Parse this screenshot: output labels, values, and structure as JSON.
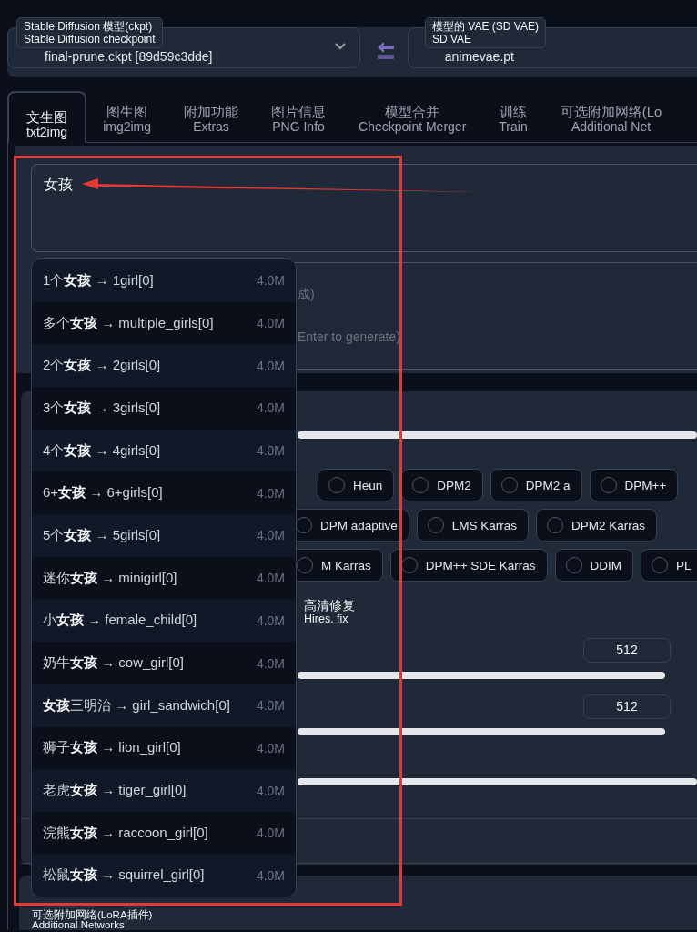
{
  "top_bar": {
    "checkpoint": {
      "label": "Stable Diffusion 模型(ckpt)",
      "sublabel": "Stable Diffusion checkpoint",
      "value": "final-prune.ckpt [89d59c3dde]"
    },
    "vae": {
      "label": "模型的 VAE (SD VAE)",
      "sublabel": "SD VAE",
      "value": "animevae.pt"
    }
  },
  "tabs": [
    {
      "label": "文生图",
      "sublabel": "txt2img",
      "selected": true
    },
    {
      "label": "图生图",
      "sublabel": "img2img",
      "selected": false
    },
    {
      "label": "附加功能",
      "sublabel": "Extras",
      "selected": false
    },
    {
      "label": "图片信息",
      "sublabel": "PNG Info",
      "selected": false
    },
    {
      "label": "模型合并",
      "sublabel": "Checkpoint Merger",
      "selected": false
    },
    {
      "label": "训练",
      "sublabel": "Train",
      "selected": false
    },
    {
      "label": "可选附加网络(Lo",
      "sublabel": "Additional Net",
      "selected": false
    }
  ],
  "prompt": {
    "value": "女孩"
  },
  "negative_prompt": {
    "placeholder": [
      "成)",
      "Enter to generate)"
    ]
  },
  "sampler_rows": [
    [
      {
        "label": "Heun",
        "selected": false
      },
      {
        "label": "DPM2",
        "selected": false
      },
      {
        "label": "DPM2 a",
        "selected": false
      },
      {
        "label": "DPM++",
        "selected": false
      }
    ],
    [
      {
        "label": "DPM adaptive",
        "selected": false
      },
      {
        "label": "LMS Karras",
        "selected": false
      },
      {
        "label": "DPM2 Karras",
        "selected": false
      }
    ],
    [
      {
        "label": "M Karras",
        "selected": false
      },
      {
        "label": "DPM++ SDE Karras",
        "selected": false
      },
      {
        "label": "DDIM",
        "selected": false
      },
      {
        "label": "PL",
        "selected": false
      }
    ]
  ],
  "hires_fix": {
    "label": "高清修复",
    "sublabel": "Hires. fix"
  },
  "width": {
    "value": "512"
  },
  "height": {
    "value": "512"
  },
  "additional_networks": {
    "label": "可选附加网络(LoRA插件)",
    "sublabel": "Additional Networks"
  },
  "autocomplete": [
    {
      "text": "1个**女孩** → 1girl[0]",
      "count": "4.0M"
    },
    {
      "text": "多个**女孩** → multiple_girls[0]",
      "count": "4.0M"
    },
    {
      "text": "2个**女孩** → 2girls[0]",
      "count": "4.0M"
    },
    {
      "text": "3个**女孩** → 3girls[0]",
      "count": "4.0M"
    },
    {
      "text": "4个**女孩** → 4girls[0]",
      "count": "4.0M"
    },
    {
      "text": "6+**女孩** → 6+girls[0]",
      "count": "4.0M"
    },
    {
      "text": "5个**女孩** → 5girls[0]",
      "count": "4.0M"
    },
    {
      "text": "迷你**女孩** → minigirl[0]",
      "count": "4.0M"
    },
    {
      "text": "小**女孩** → female_child[0]",
      "count": "4.0M"
    },
    {
      "text": "奶牛**女孩** → cow_girl[0]",
      "count": "4.0M"
    },
    {
      "text": "**女孩**三明治 → girl_sandwich[0]",
      "count": "4.0M"
    },
    {
      "text": "狮子**女孩** → lion_girl[0]",
      "count": "4.0M"
    },
    {
      "text": "老虎**女孩** → tiger_girl[0]",
      "count": "4.0M"
    },
    {
      "text": "浣熊**女孩** → raccoon_girl[0]",
      "count": "4.0M"
    },
    {
      "text": "松鼠**女孩** → squirrel_girl[0]",
      "count": "4.0M"
    }
  ]
}
